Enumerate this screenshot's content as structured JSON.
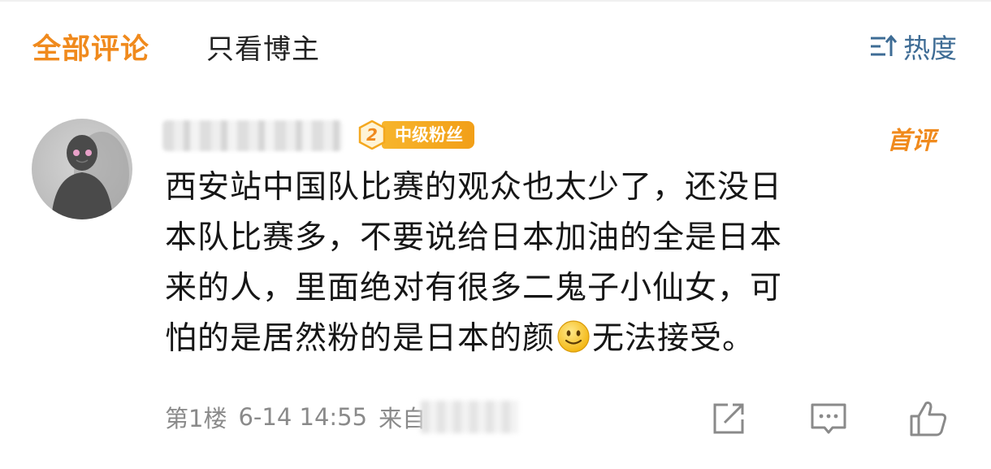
{
  "tabs": {
    "all": "全部评论",
    "owner_only": "只看博主",
    "sort": "热度"
  },
  "comment": {
    "fan_level": "2",
    "fan_badge": "中级粉丝",
    "first_tag": "首评",
    "lines": [
      "西安站中国队比赛的观众也太少了，还没日",
      "本队比赛多，不要说给日本加油的全是日本",
      "来的人，里面绝对有很多二鬼子小仙女，可"
    ],
    "line4_before": "怕的是居然粉的是日本的颜",
    "line4_after": "无法接受。",
    "floor": "第1楼",
    "time": "6-14 14:55",
    "source_prefix": "来自"
  },
  "colors": {
    "accent": "#f08a1d",
    "link_blue": "#3e6c95",
    "badge": "#f4a81f",
    "meta": "#8a8a8a"
  },
  "icons": [
    "sort-icon",
    "smiley-emoji-icon",
    "share-icon",
    "comment-icon",
    "like-icon"
  ]
}
